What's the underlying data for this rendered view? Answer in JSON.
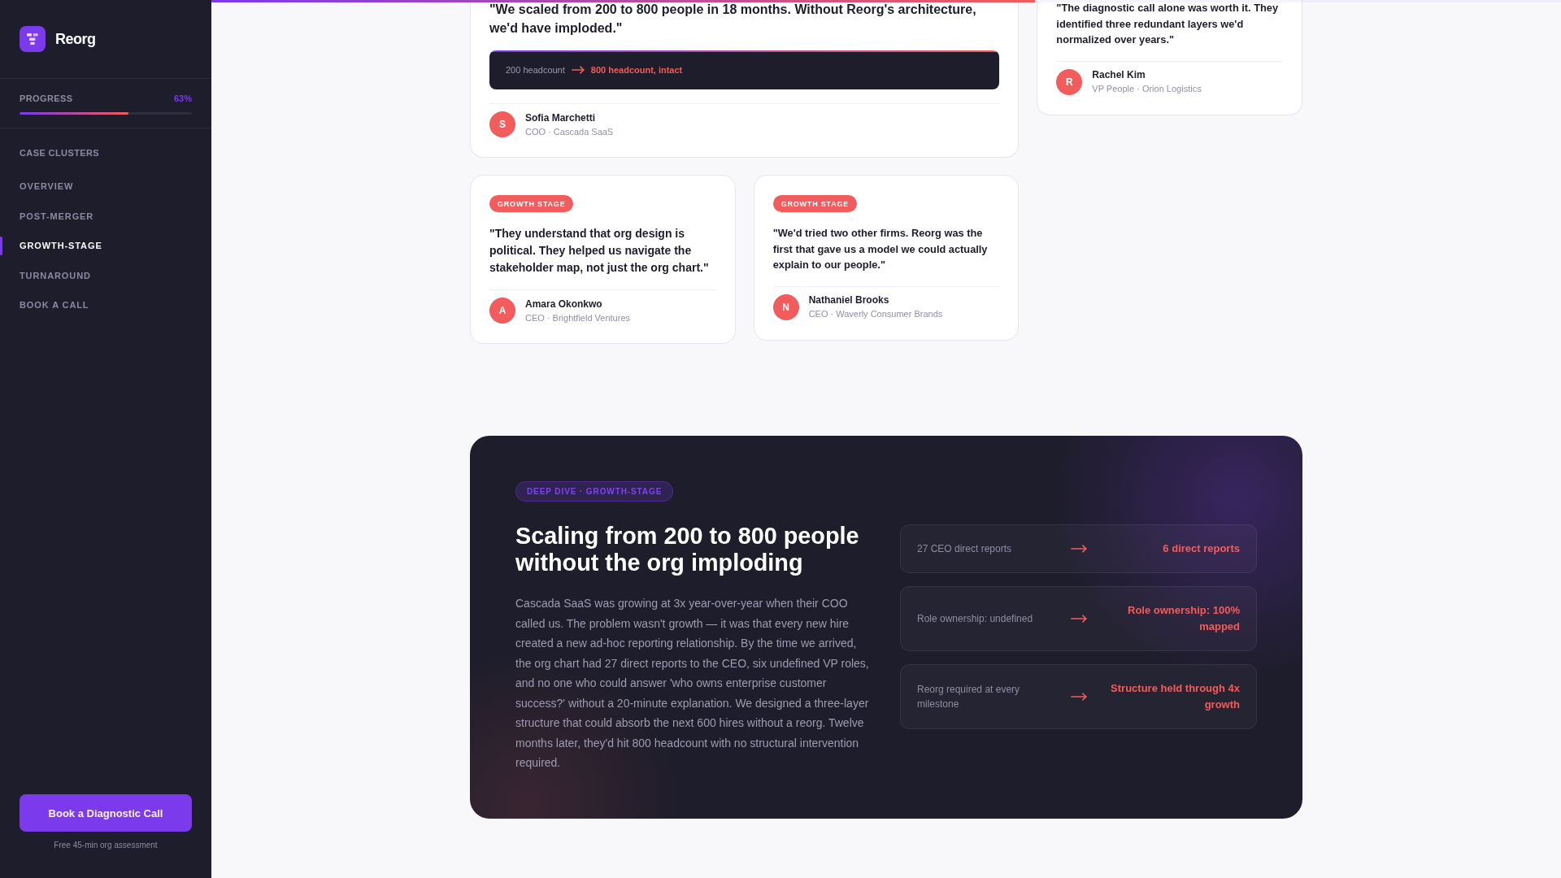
{
  "sidebar": {
    "logo": {
      "name": "Reorg"
    },
    "progress": {
      "label": "PROGRESS",
      "value": "63%",
      "level": 0.63
    },
    "section_label": "CASE CLUSTERS",
    "nav": [
      {
        "label": "OVERVIEW",
        "selected": false
      },
      {
        "label": "POST-MERGER",
        "selected": false
      },
      {
        "label": "GROWTH-STAGE",
        "selected": true
      },
      {
        "label": "TURNAROUND",
        "selected": false
      },
      {
        "label": "BOOK A CALL",
        "selected": false
      }
    ],
    "cta": {
      "label": "Book a Diagnostic Call",
      "caption": "Free 45-min org assessment"
    }
  },
  "reading_progress": {
    "level": 0.61
  },
  "testimonials": [
    {
      "kind": "featured",
      "quote": "\"We scaled from 200 to 800 people in 18 months. Without Reorg's architecture, we'd have imploded.\"",
      "metric": {
        "before": "200 headcount",
        "after": "800 headcount, intact"
      },
      "author": {
        "initial": "S",
        "name": "Sofia Marchetti",
        "role": "COO · Cascada SaaS"
      }
    },
    {
      "kind": "compact",
      "quote": "\"The diagnostic call alone was worth it. They identified three redundant layers we'd normalized over years.\"",
      "author": {
        "initial": "R",
        "name": "Rachel Kim",
        "role": "VP People · Orion Logistics"
      }
    },
    {
      "kind": "standard",
      "tag": "GROWTH STAGE",
      "quote": "\"They understand that org design is political. They helped us navigate the stakeholder map, not just the org chart.\"",
      "author": {
        "initial": "A",
        "name": "Amara Okonkwo",
        "role": "CEO · Brightfield Ventures"
      }
    },
    {
      "kind": "compact",
      "tag": "GROWTH STAGE",
      "quote": "\"We'd tried two other firms. Reorg was the first that gave us a model we could actually explain to our people.\"",
      "author": {
        "initial": "N",
        "name": "Nathaniel Brooks",
        "role": "CEO · Waverly Consumer Brands"
      }
    }
  ],
  "deep_dive": {
    "tag": "DEEP DIVE · GROWTH-STAGE",
    "title": "Scaling from 200 to 800 people without the org imploding",
    "body": "Cascada SaaS was growing at 3x year-over-year when their COO called us. The problem wasn't growth — it was that every new hire created a new ad-hoc reporting relationship. By the time we arrived, the org chart had 27 direct reports to the CEO, six undefined VP roles, and no one who could answer 'who owns enterprise customer success?' without a 20-minute explanation. We designed a three-layer structure that could absorb the next 600 hires without a reorg. Twelve months later, they'd hit 800 headcount with no structural intervention required.",
    "outcomes": [
      {
        "before": "27 CEO direct reports",
        "after": "6 direct reports"
      },
      {
        "before": "Role ownership: undefined",
        "after": "Role ownership: 100% mapped"
      },
      {
        "before": "Reorg required at every milestone",
        "after": "Structure held through 4x growth"
      }
    ]
  }
}
